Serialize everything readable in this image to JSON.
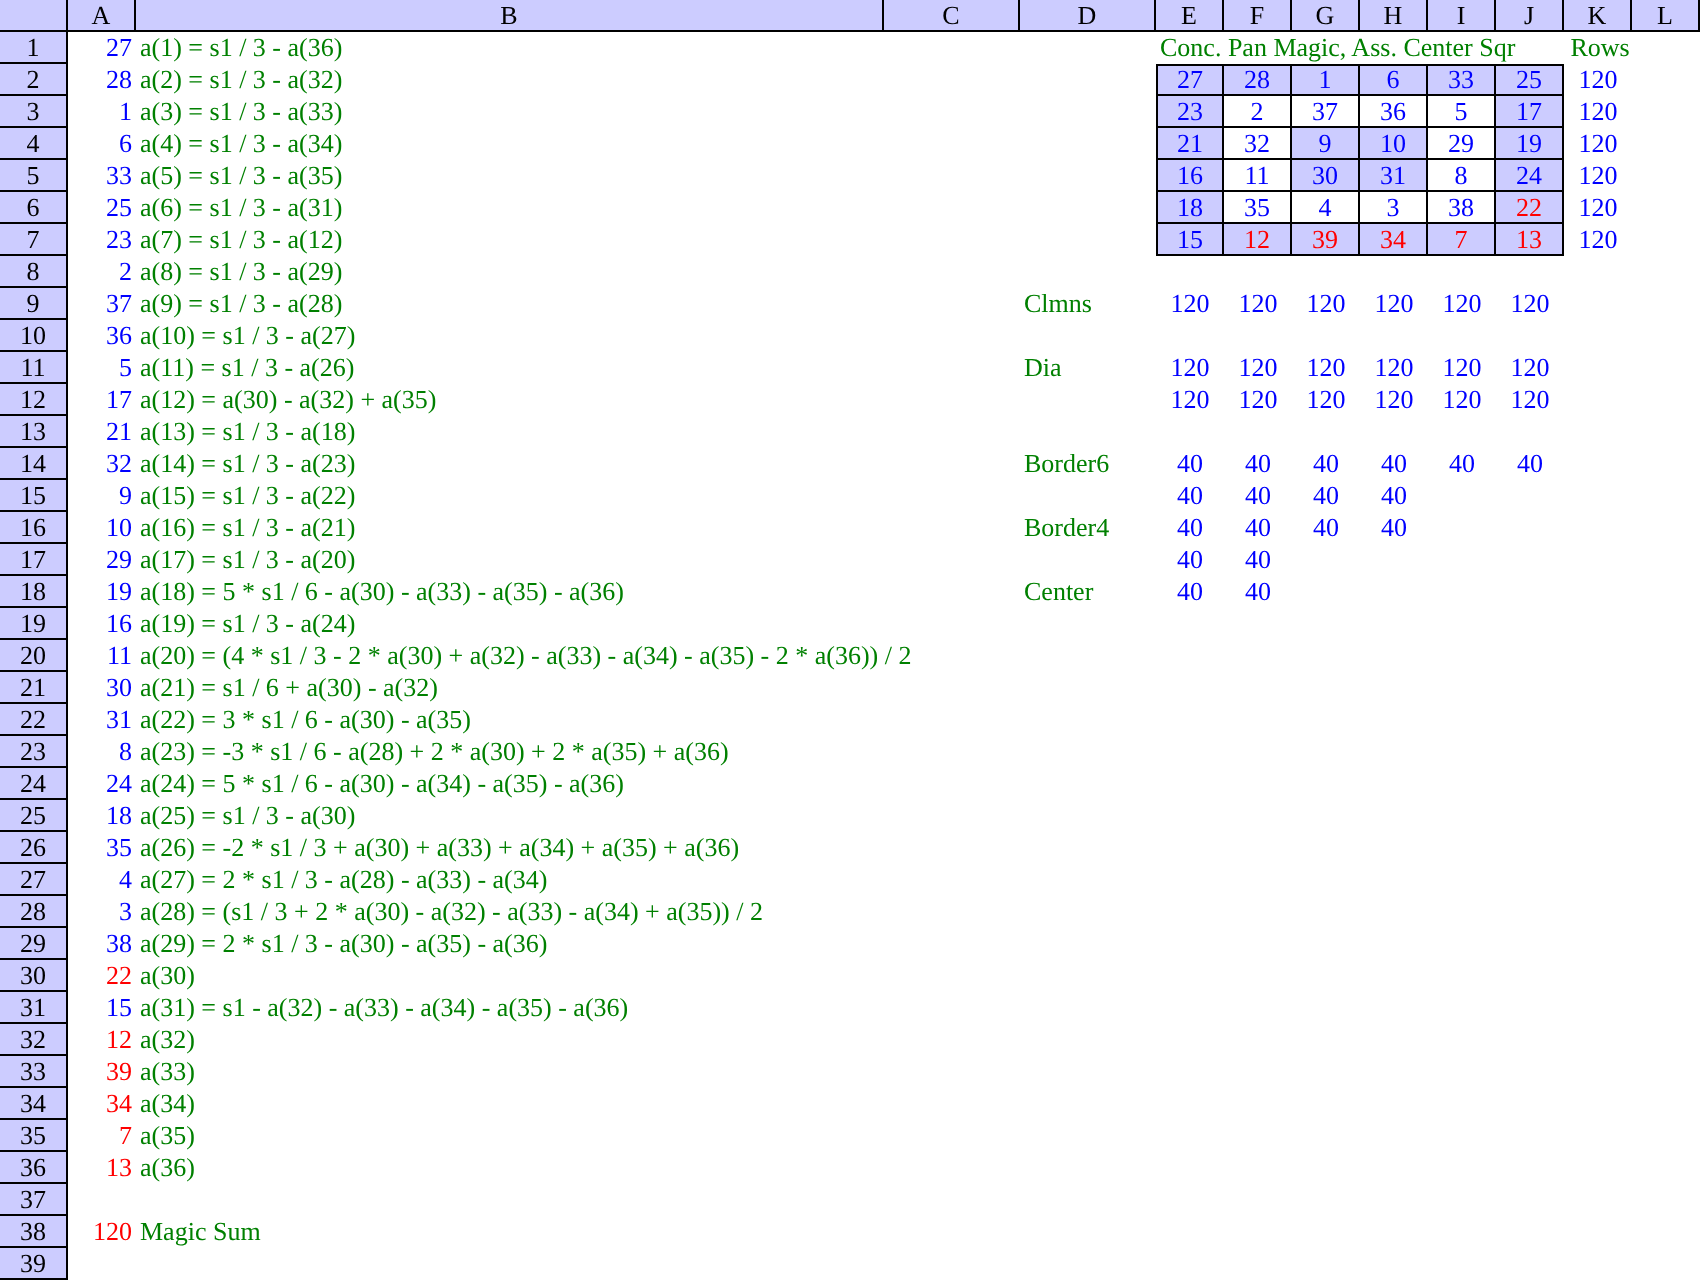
{
  "sheet": {
    "columns": [
      "A",
      "B",
      "C",
      "D",
      "E",
      "F",
      "G",
      "H",
      "I",
      "J",
      "K",
      "L"
    ],
    "rows": [
      "1",
      "2",
      "3",
      "4",
      "5",
      "6",
      "7",
      "8",
      "9",
      "10",
      "11",
      "12",
      "13",
      "14",
      "15",
      "16",
      "17",
      "18",
      "19",
      "20",
      "21",
      "22",
      "23",
      "24",
      "25",
      "26",
      "27",
      "28",
      "29",
      "30",
      "31",
      "32",
      "33",
      "34",
      "35",
      "36",
      "37",
      "38",
      "39"
    ]
  },
  "formulas": [
    {
      "value": "27",
      "color": "#0000ff",
      "text": "a(1) = s1 / 3 - a(36)"
    },
    {
      "value": "28",
      "color": "#0000ff",
      "text": "a(2) = s1 / 3 - a(32)"
    },
    {
      "value": "1",
      "color": "#0000ff",
      "text": "a(3) = s1 / 3 - a(33)"
    },
    {
      "value": "6",
      "color": "#0000ff",
      "text": "a(4) = s1 / 3 - a(34)"
    },
    {
      "value": "33",
      "color": "#0000ff",
      "text": "a(5) = s1 / 3 - a(35)"
    },
    {
      "value": "25",
      "color": "#0000ff",
      "text": "a(6) = s1 / 3 - a(31)"
    },
    {
      "value": "23",
      "color": "#0000ff",
      "text": "a(7) = s1 / 3 - a(12)"
    },
    {
      "value": "2",
      "color": "#0000ff",
      "text": "a(8) = s1 / 3 - a(29)"
    },
    {
      "value": "37",
      "color": "#0000ff",
      "text": "a(9) = s1 / 3 - a(28)"
    },
    {
      "value": "36",
      "color": "#0000ff",
      "text": "a(10) = s1 / 3 - a(27)"
    },
    {
      "value": "5",
      "color": "#0000ff",
      "text": "a(11) = s1 / 3 - a(26)"
    },
    {
      "value": "17",
      "color": "#0000ff",
      "text": "a(12) = a(30) - a(32) + a(35)"
    },
    {
      "value": "21",
      "color": "#0000ff",
      "text": "a(13) = s1 / 3 - a(18)"
    },
    {
      "value": "32",
      "color": "#0000ff",
      "text": "a(14) = s1 / 3 - a(23)"
    },
    {
      "value": "9",
      "color": "#0000ff",
      "text": "a(15) = s1 / 3 - a(22)"
    },
    {
      "value": "10",
      "color": "#0000ff",
      "text": "a(16) = s1 / 3 - a(21)"
    },
    {
      "value": "29",
      "color": "#0000ff",
      "text": "a(17) = s1 / 3 - a(20)"
    },
    {
      "value": "19",
      "color": "#0000ff",
      "text": "a(18) = 5 * s1 / 6 - a(30) - a(33) - a(35) - a(36)"
    },
    {
      "value": "16",
      "color": "#0000ff",
      "text": "a(19) = s1 / 3 - a(24)"
    },
    {
      "value": "11",
      "color": "#0000ff",
      "text": "a(20) = (4 * s1 / 3 - 2 * a(30) + a(32) - a(33) - a(34) - a(35) - 2 * a(36)) / 2"
    },
    {
      "value": "30",
      "color": "#0000ff",
      "text": "a(21) = s1 / 6 + a(30) - a(32)"
    },
    {
      "value": "31",
      "color": "#0000ff",
      "text": "a(22) = 3 * s1 / 6 - a(30) - a(35)"
    },
    {
      "value": "8",
      "color": "#0000ff",
      "text": "a(23) = -3 * s1 / 6 - a(28) + 2 * a(30) + 2 * a(35) + a(36)"
    },
    {
      "value": "24",
      "color": "#0000ff",
      "text": "a(24) = 5 * s1 / 6 - a(30) - a(34) - a(35) - a(36)"
    },
    {
      "value": "18",
      "color": "#0000ff",
      "text": "a(25) = s1 / 3 - a(30)"
    },
    {
      "value": "35",
      "color": "#0000ff",
      "text": "a(26) = -2 * s1 / 3 + a(30) + a(33) + a(34) + a(35) + a(36)"
    },
    {
      "value": "4",
      "color": "#0000ff",
      "text": "a(27) = 2 * s1 / 3 - a(28) - a(33) - a(34)"
    },
    {
      "value": "3",
      "color": "#0000ff",
      "text": "a(28) = (s1 / 3 + 2 * a(30) - a(32) - a(33) - a(34) + a(35)) / 2"
    },
    {
      "value": "38",
      "color": "#0000ff",
      "text": "a(29) = 2 * s1 / 3 - a(30) - a(35) - a(36)"
    },
    {
      "value": "22",
      "color": "#ff0000",
      "text": "a(30)"
    },
    {
      "value": "15",
      "color": "#0000ff",
      "text": "a(31) = s1 - a(32) - a(33) - a(34) - a(35) - a(36)"
    },
    {
      "value": "12",
      "color": "#ff0000",
      "text": "a(32)"
    },
    {
      "value": "39",
      "color": "#ff0000",
      "text": "a(33)"
    },
    {
      "value": "34",
      "color": "#ff0000",
      "text": "a(34)"
    },
    {
      "value": "7",
      "color": "#ff0000",
      "text": "a(35)"
    },
    {
      "value": "13",
      "color": "#ff0000",
      "text": "a(36)"
    }
  ],
  "magic_sum": {
    "value": "120",
    "color": "#ff0000",
    "label": "Magic Sum"
  },
  "square": {
    "title": "Conc. Pan Magic, Ass. Center Sqr",
    "rows_label": "Rows",
    "rows": [
      {
        "sum": "120",
        "cells": [
          {
            "value": "27",
            "shaded": true,
            "color": "#0000ff"
          },
          {
            "value": "28",
            "shaded": true,
            "color": "#0000ff"
          },
          {
            "value": "1",
            "shaded": true,
            "color": "#0000ff"
          },
          {
            "value": "6",
            "shaded": true,
            "color": "#0000ff"
          },
          {
            "value": "33",
            "shaded": true,
            "color": "#0000ff"
          },
          {
            "value": "25",
            "shaded": true,
            "color": "#0000ff"
          }
        ]
      },
      {
        "sum": "120",
        "cells": [
          {
            "value": "23",
            "shaded": true,
            "color": "#0000ff"
          },
          {
            "value": "2",
            "shaded": false,
            "color": "#0000ff"
          },
          {
            "value": "37",
            "shaded": false,
            "color": "#0000ff"
          },
          {
            "value": "36",
            "shaded": false,
            "color": "#0000ff"
          },
          {
            "value": "5",
            "shaded": false,
            "color": "#0000ff"
          },
          {
            "value": "17",
            "shaded": true,
            "color": "#0000ff"
          }
        ]
      },
      {
        "sum": "120",
        "cells": [
          {
            "value": "21",
            "shaded": true,
            "color": "#0000ff"
          },
          {
            "value": "32",
            "shaded": false,
            "color": "#0000ff"
          },
          {
            "value": "9",
            "shaded": true,
            "color": "#0000ff"
          },
          {
            "value": "10",
            "shaded": true,
            "color": "#0000ff"
          },
          {
            "value": "29",
            "shaded": false,
            "color": "#0000ff"
          },
          {
            "value": "19",
            "shaded": true,
            "color": "#0000ff"
          }
        ]
      },
      {
        "sum": "120",
        "cells": [
          {
            "value": "16",
            "shaded": true,
            "color": "#0000ff"
          },
          {
            "value": "11",
            "shaded": false,
            "color": "#0000ff"
          },
          {
            "value": "30",
            "shaded": true,
            "color": "#0000ff"
          },
          {
            "value": "31",
            "shaded": true,
            "color": "#0000ff"
          },
          {
            "value": "8",
            "shaded": false,
            "color": "#0000ff"
          },
          {
            "value": "24",
            "shaded": true,
            "color": "#0000ff"
          }
        ]
      },
      {
        "sum": "120",
        "cells": [
          {
            "value": "18",
            "shaded": true,
            "color": "#0000ff"
          },
          {
            "value": "35",
            "shaded": false,
            "color": "#0000ff"
          },
          {
            "value": "4",
            "shaded": false,
            "color": "#0000ff"
          },
          {
            "value": "3",
            "shaded": false,
            "color": "#0000ff"
          },
          {
            "value": "38",
            "shaded": false,
            "color": "#0000ff"
          },
          {
            "value": "22",
            "shaded": true,
            "color": "#ff0000"
          }
        ]
      },
      {
        "sum": "120",
        "cells": [
          {
            "value": "15",
            "shaded": true,
            "color": "#0000ff"
          },
          {
            "value": "12",
            "shaded": true,
            "color": "#ff0000"
          },
          {
            "value": "39",
            "shaded": true,
            "color": "#ff0000"
          },
          {
            "value": "34",
            "shaded": true,
            "color": "#ff0000"
          },
          {
            "value": "7",
            "shaded": true,
            "color": "#ff0000"
          },
          {
            "value": "13",
            "shaded": true,
            "color": "#ff0000"
          }
        ]
      }
    ]
  },
  "checks": [
    {
      "label": "Clmns",
      "values": [
        "120",
        "120",
        "120",
        "120",
        "120",
        "120"
      ]
    },
    {
      "label": "Dia",
      "values": [
        "120",
        "120",
        "120",
        "120",
        "120",
        "120"
      ]
    },
    {
      "values": [
        "120",
        "120",
        "120",
        "120",
        "120",
        "120"
      ]
    },
    {
      "label": "Border6",
      "values": [
        "40",
        "40",
        "40",
        "40",
        "40",
        "40"
      ]
    },
    {
      "values": [
        "40",
        "40",
        "40",
        "40"
      ]
    },
    {
      "label": "Border4",
      "values": [
        "40",
        "40",
        "40",
        "40"
      ]
    },
    {
      "values": [
        "40",
        "40"
      ]
    },
    {
      "label": "Center",
      "values": [
        "40",
        "40"
      ]
    }
  ]
}
